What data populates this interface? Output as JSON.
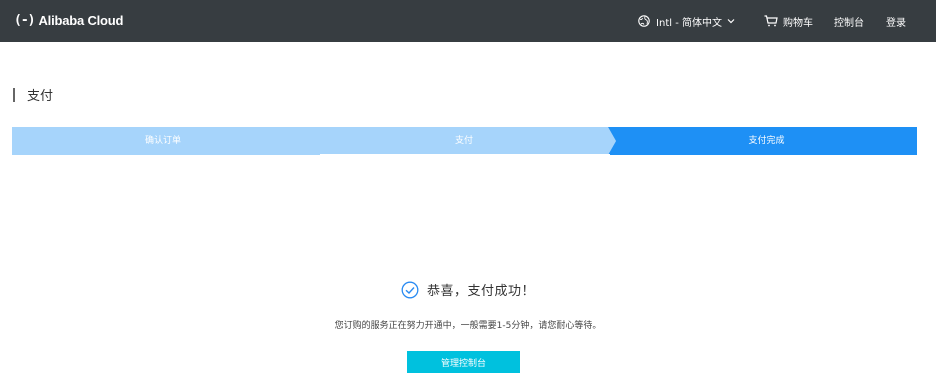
{
  "header": {
    "logo_mark": "(-)",
    "logo_text": "Alibaba Cloud",
    "region": "Intl - 简体中文",
    "cart": "购物车",
    "console": "控制台",
    "login": "登录"
  },
  "page": {
    "title": "支付"
  },
  "steps": [
    {
      "label": "确认订单",
      "state": "done"
    },
    {
      "label": "支付",
      "state": "done"
    },
    {
      "label": "支付完成",
      "state": "active"
    }
  ],
  "result": {
    "message": "恭喜，支付成功！",
    "note": "您订购的服务正在努力开通中，一般需要1-5分钟，请您耐心等待。",
    "button": "管理控制台"
  },
  "colors": {
    "topbar": "#373d41",
    "step_done": "#a6d4fb",
    "step_active": "#1e90f5",
    "success_icon": "#2a8bf2",
    "button": "#00c1de"
  }
}
